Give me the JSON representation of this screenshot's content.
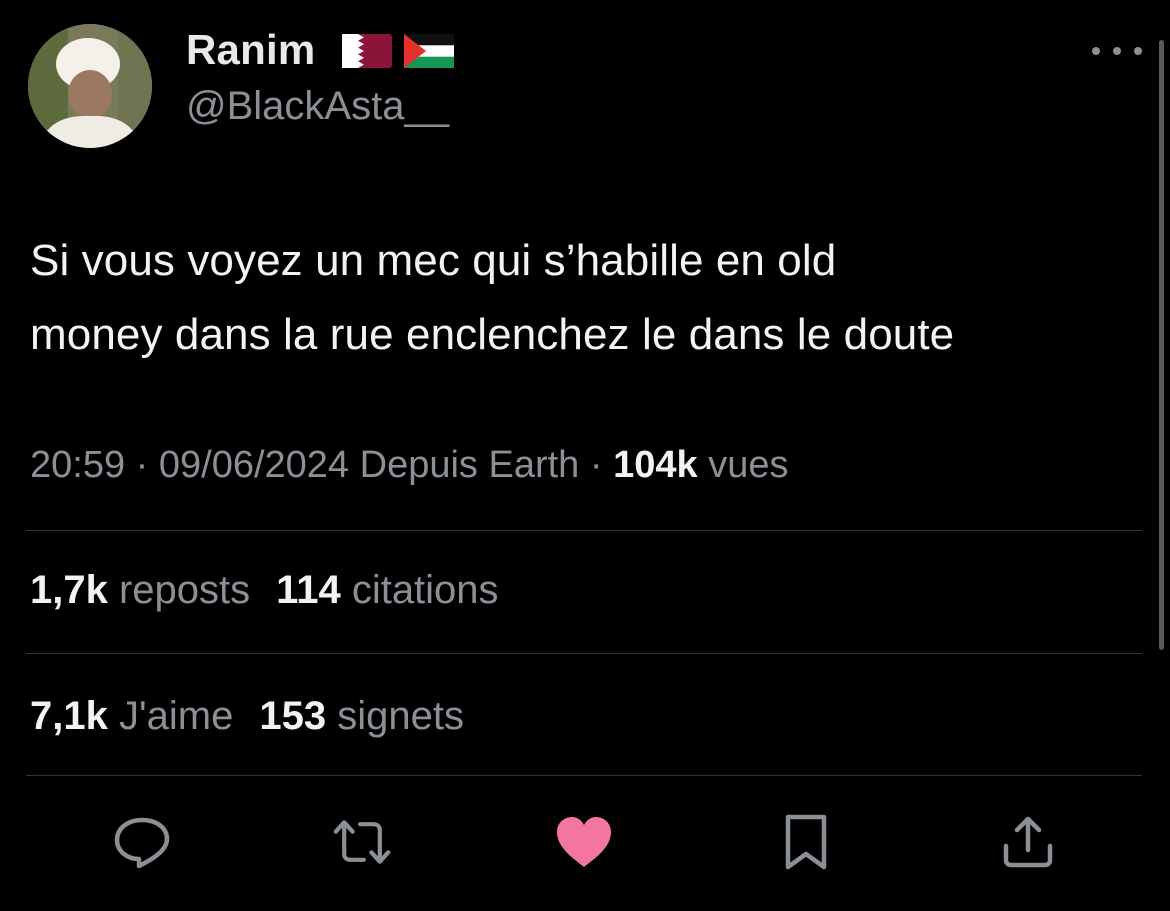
{
  "user": {
    "name": "Ranim",
    "handle": "@BlackAsta__",
    "flags": [
      "qatar-flag",
      "palestine-flag"
    ]
  },
  "tweet": {
    "text_line1": "Si vous voyez un mec qui s’habille en old",
    "text_line2": "money dans la rue enclenchez le dans le doute"
  },
  "meta": {
    "time": "20:59",
    "sep1": "·",
    "date": "09/06/2024",
    "source": "Depuis Earth",
    "sep2": "·",
    "views_count": "104k",
    "views_label": "vues"
  },
  "stats": {
    "reposts_count": "1,7k",
    "reposts_label": "reposts",
    "quotes_count": "114",
    "quotes_label": "citations",
    "likes_count": "7,1k",
    "likes_label": "J'aime",
    "bookmarks_count": "153",
    "bookmarks_label": "signets"
  },
  "actions": [
    "reply-icon",
    "repost-icon",
    "like-icon",
    "bookmark-icon",
    "share-icon"
  ],
  "colors": {
    "background": "#000000",
    "text": "#e7e9ea",
    "muted": "#8b9096",
    "like": "#f4759e",
    "divider": "#2f3336"
  }
}
